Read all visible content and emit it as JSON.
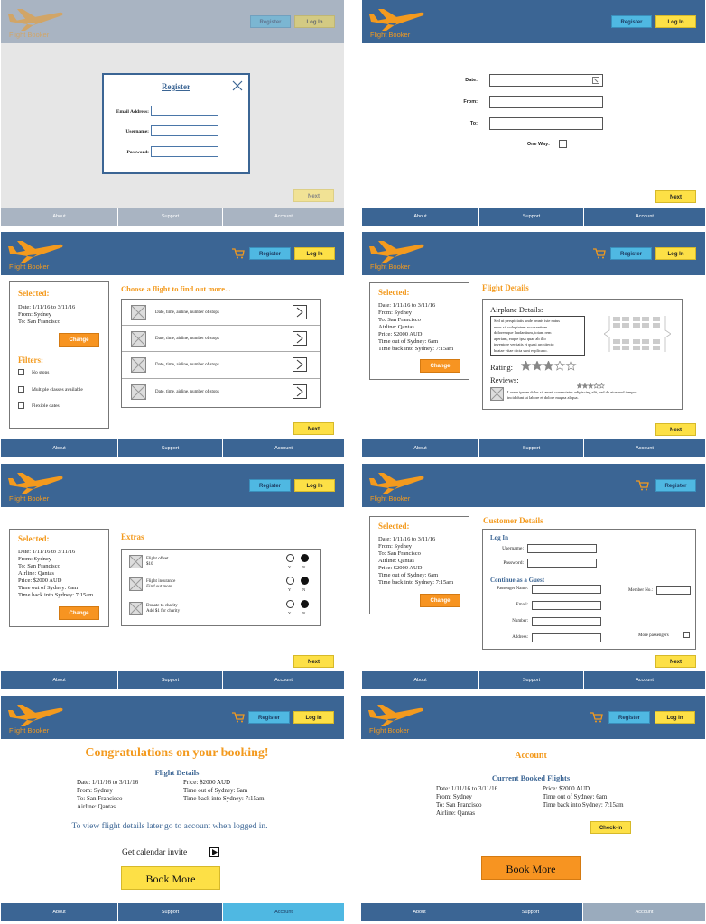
{
  "brand": {
    "name": "Flight Booker"
  },
  "colors": {
    "header": "#3b6594",
    "accent": "#f39a1e",
    "register": "#4fb8e2",
    "login": "#fde046",
    "change": "#f79421"
  },
  "header": {
    "register": "Register",
    "login": "Log In"
  },
  "footer": {
    "about": "About",
    "support": "Support",
    "account": "Account"
  },
  "common": {
    "next": "Next",
    "change": "Change",
    "selected": "Selected:"
  },
  "trip": {
    "date": "Date: 1/11/16 to 3/11/16",
    "from": "From: Sydney",
    "to": "To: San Francisco",
    "airline": "Airline: Qantas",
    "price": "Price: $2000 AUD",
    "out": "Time out of Sydney: 6am",
    "back": "Time back into Sydney: 7:15am"
  },
  "s1": {
    "modal_title": "Register",
    "email": "Email Address:",
    "username": "Username:",
    "password": "Password:"
  },
  "s2": {
    "date": "Date:",
    "from": "From:",
    "to": "To:",
    "oneway": "One Way:"
  },
  "s3": {
    "choose": "Choose a flight to find out more...",
    "row_text": "Date, time, airline, number of stops",
    "filters": "Filters:",
    "filter_items": [
      "No stops",
      "Multiple classes available",
      "Flexible dates"
    ]
  },
  "s4": {
    "title": "Flight Details",
    "airplane": "Airplane Details:",
    "lorem": [
      "Sed ut perspiciatis unde omnis iste natus",
      "error sit voluptatem accusantium",
      "doloremque laudantium, totam rem",
      "aperiam, eaque ipsa quae ab illo",
      "inventore veritatis et quasi architecto",
      "beatae vitae dicta sunt explicabo."
    ],
    "rating": "Rating:",
    "rating_value": 3,
    "rating_max": 5,
    "reviews": "Reviews:",
    "review_stars": 3,
    "review_text": [
      "Lorem ipsum dolor sit amet, consectetur adipiscing elit, sed do eiusmod tempor",
      "incididunt ut labore et dolore magna aliqua."
    ]
  },
  "s5": {
    "extras": "Extras",
    "items": [
      {
        "l1": "Flight offset",
        "l2": "$10"
      },
      {
        "l1": "Flight insurance",
        "l2": "Find out more"
      },
      {
        "l1": "Donate to charity",
        "l2": "Add $1 for charity"
      }
    ],
    "yes": "Y",
    "no": "N"
  },
  "s6": {
    "title": "Customer Details",
    "login": "Log In",
    "username": "Username:",
    "password": "Password:",
    "guest": "Continue as a Guest",
    "passenger": "Passenger Name:",
    "member": "Member No.:",
    "email": "Email:",
    "number": "Number:",
    "address": "Address:",
    "more": "More passengers"
  },
  "s7": {
    "congrats": "Congratulations on your booking!",
    "details": "Flight Details",
    "view": "To view flight details later go to account when logged in.",
    "calendar": "Get calendar invite",
    "book_more": "Book More"
  },
  "s8": {
    "account": "Account",
    "current": "Current Booked Flights",
    "checkin": "Check-In",
    "book_more": "Book More"
  }
}
